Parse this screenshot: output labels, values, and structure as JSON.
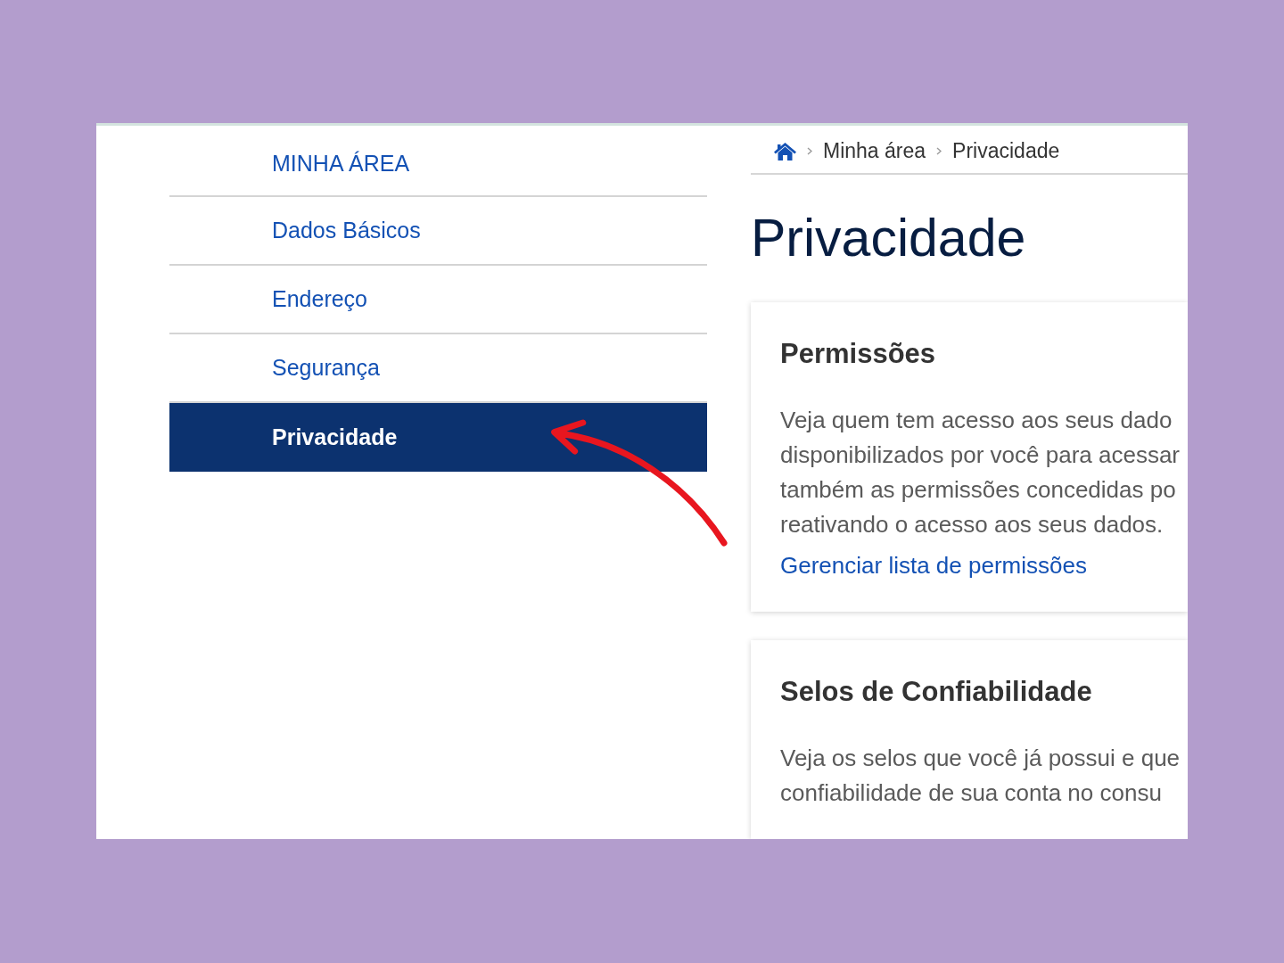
{
  "sidebar": {
    "title": "MINHA ÁREA",
    "items": [
      {
        "label": "Dados Básicos",
        "selected": false
      },
      {
        "label": "Endereço",
        "selected": false
      },
      {
        "label": "Segurança",
        "selected": false
      },
      {
        "label": "Privacidade",
        "selected": true
      }
    ]
  },
  "breadcrumb": {
    "items": [
      "Minha área",
      "Privacidade"
    ]
  },
  "page_title": "Privacidade",
  "cards": [
    {
      "title": "Permissões",
      "text_lines": [
        "Veja quem tem acesso aos seus dado",
        "disponibilizados por você para acessar",
        "também as permissões concedidas po",
        "reativando o acesso aos seus dados."
      ],
      "link": "Gerenciar lista de permissões"
    },
    {
      "title": "Selos de Confiabilidade",
      "text_lines": [
        "Veja os selos que você já possui e que",
        "confiabilidade de sua conta no consu"
      ]
    }
  ]
}
